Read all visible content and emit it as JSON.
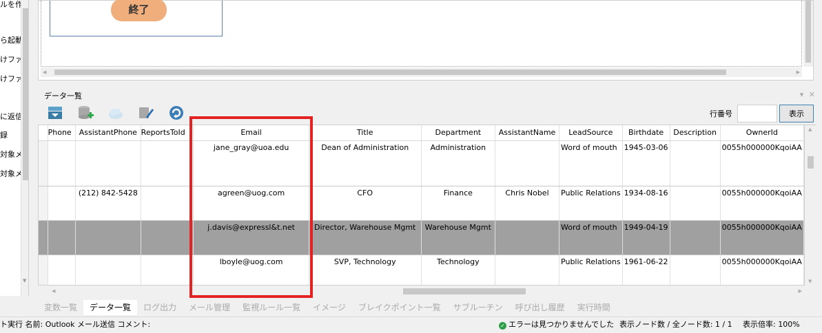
{
  "left_panel": {
    "items": [
      "ルを作",
      "ら起動",
      "けファイ",
      "けファイ",
      "に返信",
      "録",
      "対象メ",
      "対象メ"
    ]
  },
  "canvas": {
    "end_node_label": "終了"
  },
  "data_panel": {
    "title": "データ一覧",
    "controls": "▾ ✕",
    "toolbar": [
      "export-icon",
      "add-database-icon",
      "cloud-icon",
      "brush-edit-icon",
      "refresh-icon"
    ],
    "row_number_label": "行番号",
    "row_number_value": "",
    "show_button": "表示",
    "columns": [
      "Phone",
      "AssistantPhone",
      "ReportsToId",
      "Email",
      "Title",
      "Department",
      "AssistantName",
      "LeadSource",
      "Birthdate",
      "Description",
      "OwnerId"
    ],
    "rows": [
      [
        "",
        "",
        "",
        "jane_gray@uoa.edu",
        "Dean of Administration",
        "Administration",
        "",
        "Word of mouth",
        "1945-03-06",
        "",
        "0055h000000KqoiAA"
      ],
      [
        "",
        "(212) 842-5428",
        "",
        "agreen@uog.com",
        "CFO",
        "Finance",
        "Chris Nobel",
        "Public Relations",
        "1934-08-16",
        "",
        "0055h000000KqoiAA"
      ],
      [
        "",
        "",
        "",
        "j.davis@expressl&t.net",
        "Director, Warehouse Mgmt",
        "Warehouse Mgmt",
        "",
        "Word of mouth",
        "1949-04-19",
        "",
        "0055h000000KqoiAA"
      ],
      [
        "",
        "",
        "",
        "lboyle@uog.com",
        "SVP, Technology",
        "Technology",
        "",
        "Public Relations",
        "1961-06-22",
        "",
        "0055h000000KqoiAA"
      ]
    ],
    "selected_row": 2
  },
  "tabs": [
    {
      "label": "変数一覧",
      "active": false
    },
    {
      "label": "データ一覧",
      "active": true
    },
    {
      "label": "ログ出力",
      "active": false
    },
    {
      "label": "メール管理",
      "active": false
    },
    {
      "label": "監視ルール一覧",
      "active": false
    },
    {
      "label": "イメージ",
      "active": false
    },
    {
      "label": "ブレイクポイント一覧",
      "active": false
    },
    {
      "label": "サブルーチン",
      "active": false
    },
    {
      "label": "呼び出し履歴",
      "active": false
    },
    {
      "label": "実行時間",
      "active": false
    }
  ],
  "status": {
    "left_text": "ト実行 名前: Outlook メール送信 コメント:",
    "error_text": "エラーは見つかりませんでした",
    "node_count": "表示ノード数 / 全ノード数: 1 / 1",
    "zoom": "表示倍率: 100%"
  },
  "colors": {
    "end_node": "#f0ae7c",
    "highlight": "#e32222",
    "selected_row": "#a0a0a0"
  }
}
